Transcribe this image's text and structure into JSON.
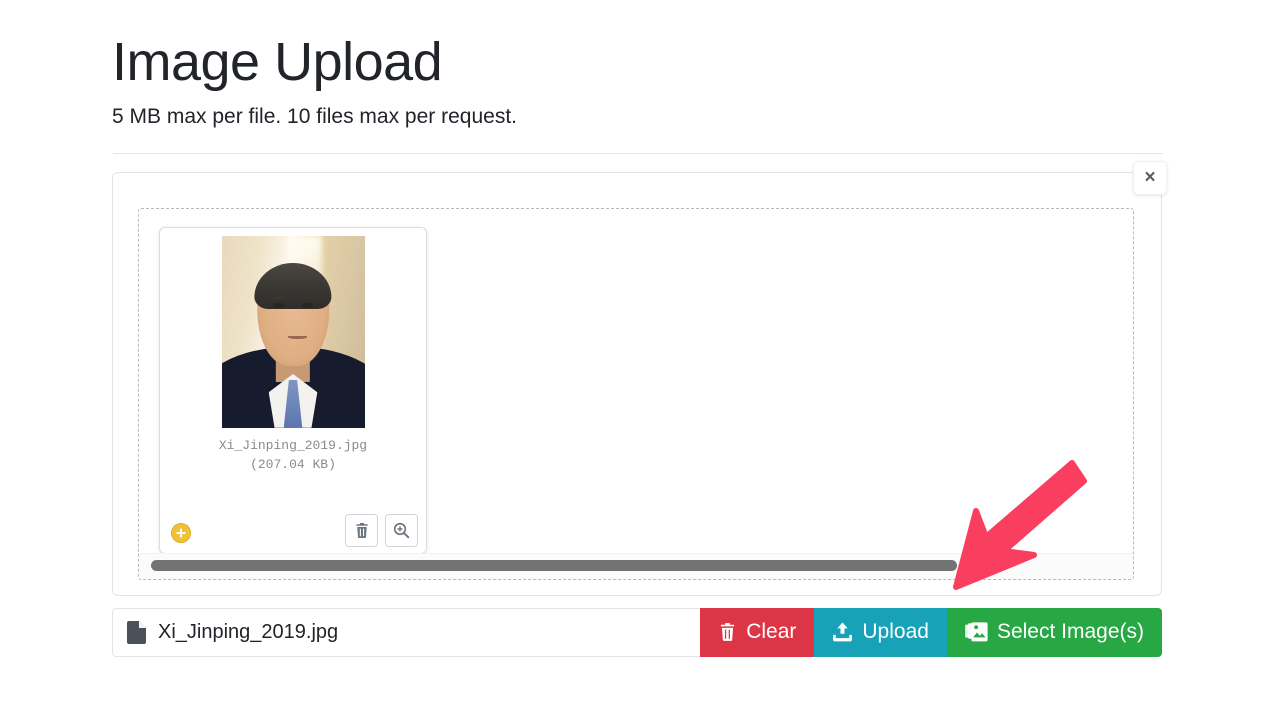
{
  "header": {
    "title": "Image Upload",
    "subtitle": "5 MB max per file. 10 files max per request."
  },
  "upload_panel": {
    "close_label": "×",
    "close_icon": "close-icon",
    "dropzone_hint": "",
    "files": [
      {
        "name": "Xi_Jinping_2019.jpg",
        "size": "(207.04 KB)",
        "drag_icon": "move-plus-icon",
        "delete_icon": "trash-icon",
        "zoom_icon": "magnifier-plus-icon"
      }
    ],
    "scrollbar": {
      "orientation": "horizontal",
      "thumb_color": "#737373"
    }
  },
  "action_bar": {
    "file_caption": "Xi_Jinping_2019.jpg",
    "file_icon": "file-icon",
    "buttons": [
      {
        "label": "Clear",
        "icon": "trash-icon",
        "color": "#dc3545"
      },
      {
        "label": "Upload",
        "icon": "upload-icon",
        "color": "#17a2b8"
      },
      {
        "label": "Select Image(s)",
        "icon": "images-icon",
        "color": "#28a745"
      }
    ]
  },
  "annotation": {
    "arrow_icon": "arrow-pointing-down-left",
    "color": "#f93e5f"
  }
}
